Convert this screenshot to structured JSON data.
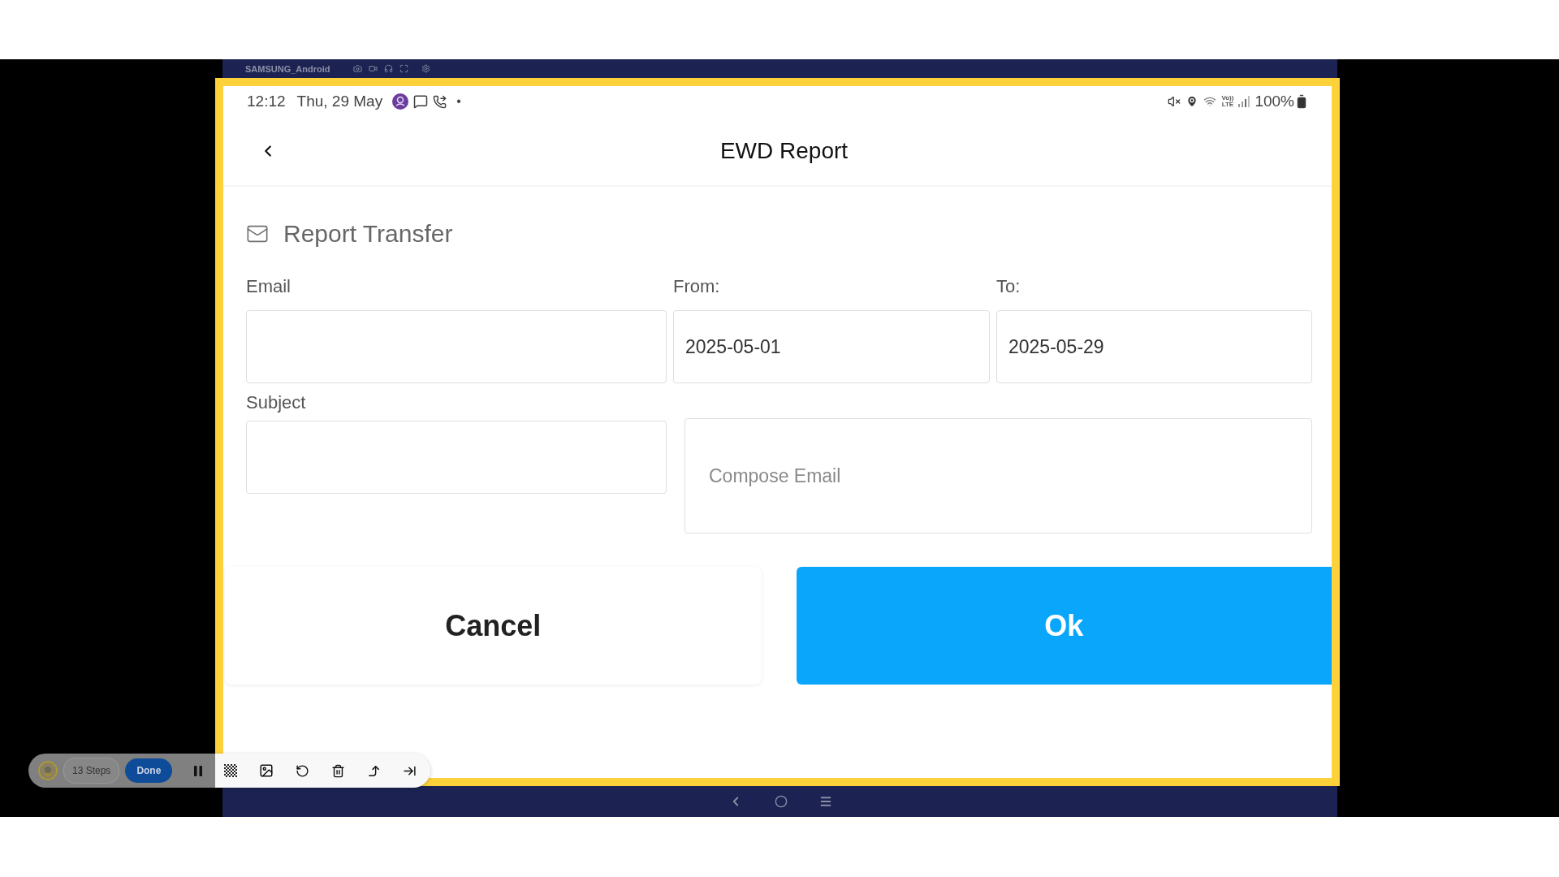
{
  "device_bar": {
    "title": "SAMSUNG_Android"
  },
  "status_bar": {
    "time": "12:12",
    "date": "Thu, 29 May",
    "dot": "•",
    "volte": [
      "Vo))",
      "LTE"
    ],
    "battery": "100%"
  },
  "header": {
    "title": "EWD Report"
  },
  "section": {
    "title": "Report Transfer"
  },
  "form": {
    "email": {
      "label": "Email"
    },
    "from": {
      "label": "From:",
      "value": "2025-05-01"
    },
    "to": {
      "label": "To:",
      "value": "2025-05-29"
    },
    "subject": {
      "label": "Subject"
    },
    "body": {
      "placeholder": "Compose Email"
    }
  },
  "buttons": [
    {
      "label": "Cancel",
      "kind": "secondary"
    },
    {
      "label": "Ok",
      "kind": "primary"
    }
  ],
  "recorder_toolbar": {
    "steps": "13 Steps",
    "done": "Done"
  }
}
